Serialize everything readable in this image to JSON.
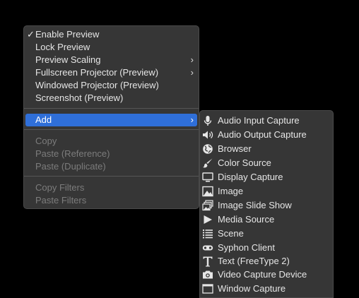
{
  "main_menu": {
    "items": [
      {
        "label": "Enable Preview",
        "checked": true
      },
      {
        "label": "Lock Preview"
      },
      {
        "label": "Preview Scaling",
        "submenu": true
      },
      {
        "label": "Fullscreen Projector (Preview)",
        "submenu": true
      },
      {
        "label": "Windowed Projector (Preview)"
      },
      {
        "label": "Screenshot (Preview)"
      },
      {
        "label": "Add",
        "submenu": true,
        "highlighted": true
      },
      {
        "label": "Copy",
        "disabled": true
      },
      {
        "label": "Paste (Reference)",
        "disabled": true
      },
      {
        "label": "Paste (Duplicate)",
        "disabled": true
      },
      {
        "label": "Copy Filters",
        "disabled": true
      },
      {
        "label": "Paste Filters",
        "disabled": true
      }
    ],
    "check_mark": "✓",
    "submenu_arrow": "›"
  },
  "add_submenu": {
    "items": [
      {
        "label": "Audio Input Capture",
        "icon": "microphone-icon"
      },
      {
        "label": "Audio Output Capture",
        "icon": "speaker-icon"
      },
      {
        "label": "Browser",
        "icon": "globe-icon"
      },
      {
        "label": "Color Source",
        "icon": "paintbrush-icon"
      },
      {
        "label": "Display Capture",
        "icon": "monitor-icon"
      },
      {
        "label": "Image",
        "icon": "image-icon"
      },
      {
        "label": "Image Slide Show",
        "icon": "slideshow-icon"
      },
      {
        "label": "Media Source",
        "icon": "play-icon"
      },
      {
        "label": "Scene",
        "icon": "list-icon"
      },
      {
        "label": "Syphon Client",
        "icon": "gamepad-icon"
      },
      {
        "label": "Text (FreeType 2)",
        "icon": "text-icon"
      },
      {
        "label": "Video Capture Device",
        "icon": "camera-icon"
      },
      {
        "label": "Window Capture",
        "icon": "window-icon"
      }
    ]
  },
  "colors": {
    "menu_bg": "#363636",
    "highlight": "#2f6fd9",
    "text": "#e6e6e6",
    "disabled_text": "#7c7c7c"
  }
}
